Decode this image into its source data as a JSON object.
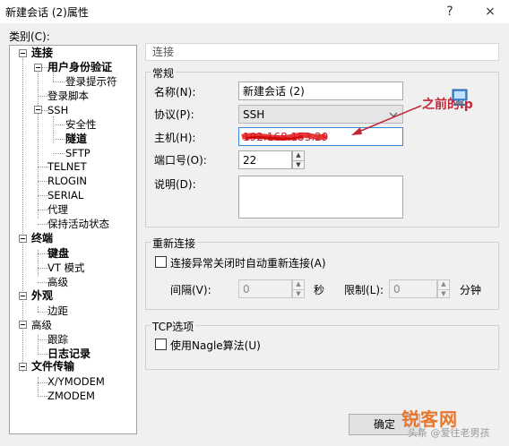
{
  "window": {
    "title": "新建会话 (2)属性",
    "help_icon": "?",
    "close_icon": "×"
  },
  "category_label": "类别(C):",
  "tree": {
    "connection": "连接",
    "user_auth": "用户身份验证",
    "login_prompt": "登录提示符",
    "login_script": "登录脚本",
    "ssh": "SSH",
    "security": "安全性",
    "tunnel": "隧道",
    "sftp": "SFTP",
    "telnet": "TELNET",
    "rlogin": "RLOGIN",
    "serial": "SERIAL",
    "proxy": "代理",
    "keepalive": "保持活动状态",
    "terminal": "终端",
    "keyboard": "键盘",
    "vt_mode": "VT 模式",
    "advanced": "高级",
    "appearance": "外观",
    "margins": "边距",
    "advanced2": "高级",
    "tracking": "跟踪",
    "logging": "日志记录",
    "file_transfer": "文件传输",
    "xymodem": "X/YMODEM",
    "zmodem": "ZMODEM"
  },
  "panel": {
    "header": "连接",
    "general": {
      "group_label": "常规",
      "name_label": "名称(N):",
      "name_value": "新建会话 (2)",
      "protocol_label": "协议(P):",
      "protocol_value": "SSH",
      "host_label": "主机(H):",
      "host_value": "192.168.153.29",
      "port_label": "端口号(O):",
      "port_value": "22",
      "desc_label": "说明(D):",
      "desc_value": ""
    },
    "reconnect": {
      "group_label": "重新连接",
      "checkbox_label": "连接异常关闭时自动重新连接(A)",
      "interval_label": "间隔(V):",
      "interval_value": "0",
      "seconds_label": "秒",
      "limit_label": "限制(L):",
      "limit_value": "0",
      "minutes_label": "分钟"
    },
    "tcp": {
      "group_label": "TCP选项",
      "nagle_label": "使用Nagle算法(U)"
    }
  },
  "annotation": {
    "text": "之前的ip",
    "color": "#c0283a"
  },
  "buttons": {
    "ok": "确定"
  },
  "watermark": {
    "logo": "锐客网",
    "text": "头条 @爱往老男孩"
  }
}
